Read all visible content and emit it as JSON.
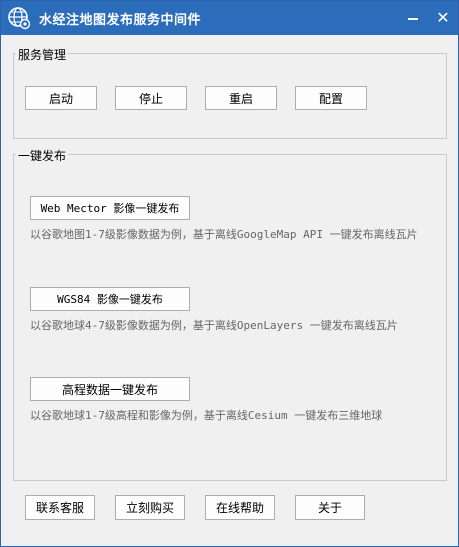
{
  "window": {
    "title": "水经注地图发布服务中间件",
    "minimize_label": "—",
    "close_label": "✕",
    "app_icon": "globe-gear-icon",
    "title_bar_color": "#2b6dbb"
  },
  "service_group": {
    "label": "服务管理",
    "buttons": {
      "start": "启动",
      "stop": "停止",
      "restart": "重启",
      "config": "配置"
    }
  },
  "publish_group": {
    "label": "一键发布",
    "items": [
      {
        "button": "Web Mector 影像一键发布",
        "description": "以谷歌地图1-7级影像数据为例，基于离线GoogleMap API 一键发布离线瓦片"
      },
      {
        "button": "WGS84 影像一键发布",
        "description": "以谷歌地球4-7级影像数据为例，基于离线OpenLayers 一键发布离线瓦片"
      },
      {
        "button": "高程数据一键发布",
        "description": "以谷歌地球1-7级高程和影像为例，基于离线Cesium 一键发布三维地球"
      }
    ]
  },
  "footer": {
    "contact": "联系客服",
    "buy": "立刻购买",
    "help": "在线帮助",
    "about": "关于"
  }
}
